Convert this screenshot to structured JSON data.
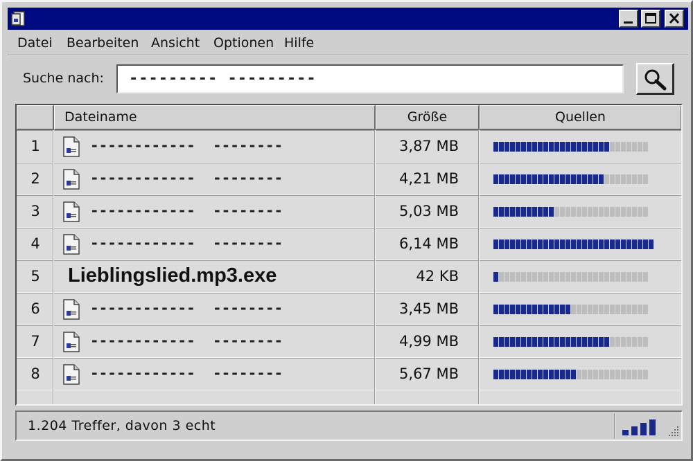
{
  "menu": [
    "Datei",
    "Bearbeiten",
    "Ansicht",
    "Optionen",
    "Hilfe"
  ],
  "search": {
    "label": "Suche nach:",
    "value": "---------  ---------"
  },
  "table": {
    "headers": [
      "",
      "Dateiname",
      "Größe",
      "Quellen"
    ],
    "rows": [
      {
        "num": "1",
        "name": "------------  --------",
        "size": "3,87 MB",
        "sources": 0.75,
        "segments_total": 28,
        "has_icon": true,
        "highlight": false
      },
      {
        "num": "2",
        "name": "------------  --------",
        "size": "4,21 MB",
        "sources": 0.71,
        "segments_total": 28,
        "has_icon": true,
        "highlight": false
      },
      {
        "num": "3",
        "name": "------------  --------",
        "size": "5,03 MB",
        "sources": 0.39,
        "segments_total": 28,
        "has_icon": true,
        "highlight": false
      },
      {
        "num": "4",
        "name": "------------  --------",
        "size": "6,14 MB",
        "sources": 1.0,
        "segments_total": 29,
        "has_icon": true,
        "highlight": false
      },
      {
        "num": "5",
        "name": "Lieblingslied.mp3.exe",
        "size": "42 KB",
        "sources": 0.04,
        "segments_total": 28,
        "has_icon": false,
        "highlight": true
      },
      {
        "num": "6",
        "name": "------------  --------",
        "size": "3,45 MB",
        "sources": 0.5,
        "segments_total": 28,
        "has_icon": true,
        "highlight": false
      },
      {
        "num": "7",
        "name": "------------  --------",
        "size": "4,99 MB",
        "sources": 0.75,
        "segments_total": 28,
        "has_icon": true,
        "highlight": false
      },
      {
        "num": "8",
        "name": "------------  --------",
        "size": "5,67 MB",
        "sources": 0.54,
        "segments_total": 28,
        "has_icon": true,
        "highlight": false
      }
    ]
  },
  "status": {
    "text": "1.204 Treffer, davon 3 echt",
    "signal_level": 4
  },
  "colors": {
    "titlebar": "#000a80",
    "bar_filled": "#1a2a8a",
    "bar_empty": "#bdbdbd"
  },
  "icons": [
    "app-icon",
    "minimize-icon",
    "maximize-icon",
    "close-icon",
    "search-icon",
    "file-icon",
    "signal-icon",
    "resize-grip-icon"
  ]
}
